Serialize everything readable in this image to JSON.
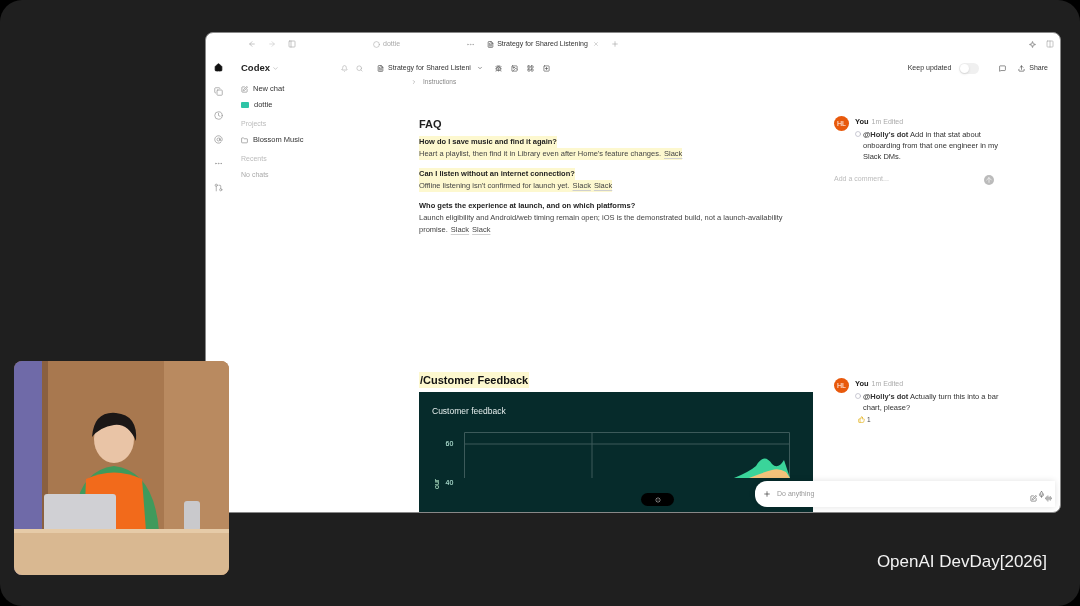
{
  "rail": [
    {
      "kind": "home",
      "selected": true
    },
    {
      "kind": "copy",
      "selected": false
    },
    {
      "kind": "clock",
      "selected": false
    },
    {
      "kind": "at",
      "selected": false
    },
    {
      "kind": "more",
      "selected": false
    },
    {
      "kind": "branch",
      "selected": false
    }
  ],
  "tabs": [
    {
      "label": "dottie",
      "kind": "chat",
      "selected": false
    },
    {
      "label": "Strategy for Shared Listening",
      "kind": "doc",
      "selected": true
    }
  ],
  "sidebar": {
    "title": "Codex",
    "items": [
      {
        "label": "New chat",
        "kind": "new"
      },
      {
        "label": "dottie",
        "kind": "agent"
      }
    ],
    "sections": [
      {
        "title": "Projects",
        "items": [
          {
            "label": "Blossom Music",
            "disabled": false
          }
        ]
      },
      {
        "title": "Recents",
        "items": [
          {
            "label": "No chats",
            "disabled": true
          }
        ]
      }
    ]
  },
  "toolbar": {
    "doc_title": "Strategy for Shared Listeni",
    "keep_updated": {
      "label": "Keep updated",
      "on": false
    },
    "share": "Share"
  },
  "breadcrumb": {
    "label": "Instructions",
    "expanded": false
  },
  "faq": {
    "title": "FAQ",
    "items": [
      {
        "question": "How do I save music and find it again?",
        "answer": "Heart a playlist, then find it in Library even after Home's feature changes.",
        "sources": [
          "Slack"
        ],
        "highlighted": true
      },
      {
        "question": "Can I listen without an internet connection?",
        "answer": "Offline listening isn't confirmed for launch yet.",
        "sources": [
          "Slack",
          "Slack"
        ],
        "highlighted": true
      },
      {
        "question": "Who gets the experience at launch, and on which platforms?",
        "answer": "Launch eligibility and Android/web timing remain open; iOS is the demonstrated build, not a launch-availability promise.",
        "sources": [
          "Slack",
          "Slack"
        ],
        "highlighted": false
      }
    ]
  },
  "comments": [
    {
      "avatar": "HL",
      "author": "You",
      "meta": "1m Edited",
      "mention": "@Holly's dot",
      "text": "Add in that stat about onboarding from that one engineer in my Slack DMs.",
      "reply_placeholder": "Add a comment..."
    },
    {
      "avatar": "HL",
      "author": "You",
      "meta": "1m Edited",
      "mention": "@Holly's dot",
      "text": "Actually turn this into a bar chart, please?",
      "reaction_count": "1"
    }
  ],
  "feedback": {
    "heading": "/Customer Feedback",
    "chart_title": "Customer feedback",
    "y_ticks": [
      "60",
      "40"
    ],
    "ylabel": "our"
  },
  "composer": {
    "placeholder": "Do anything"
  },
  "event_label": "OpenAI DevDay[2026]"
}
